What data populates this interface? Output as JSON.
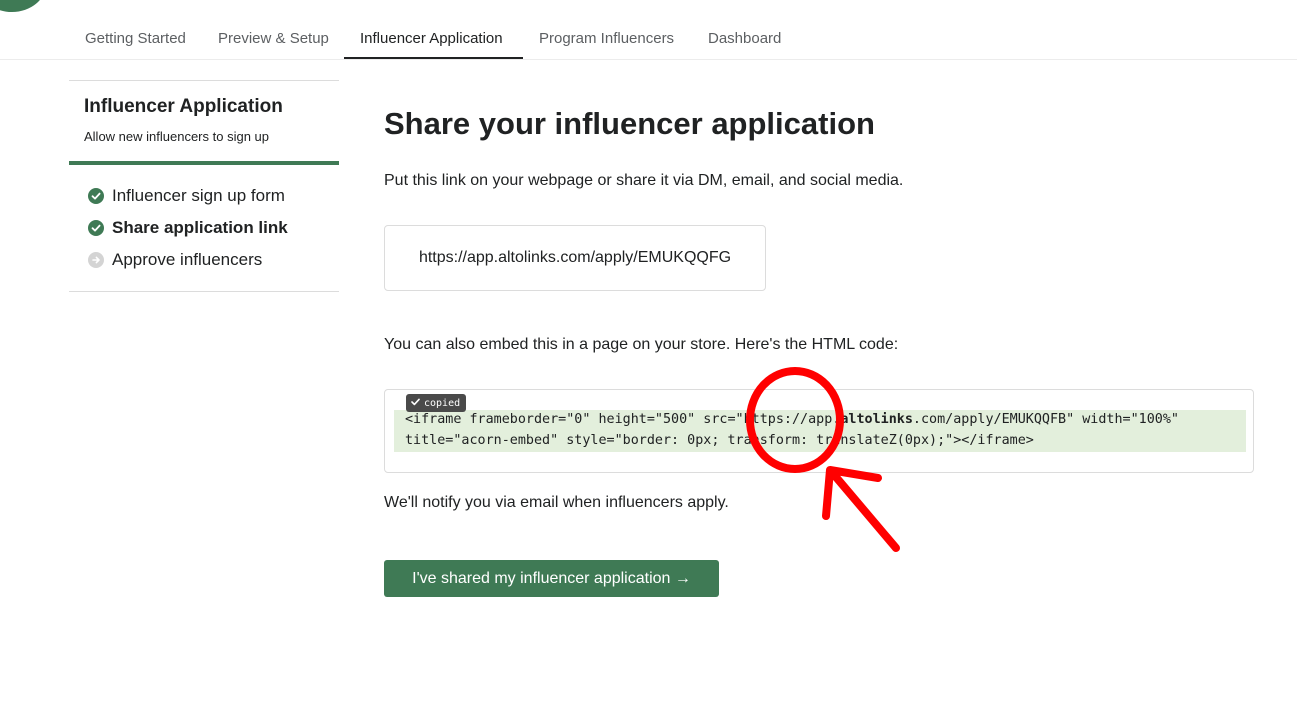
{
  "tabs": [
    {
      "label": "Getting Started",
      "active": false
    },
    {
      "label": "Preview & Setup",
      "active": false
    },
    {
      "label": "Influencer Application",
      "active": true
    },
    {
      "label": "Program Influencers",
      "active": false
    },
    {
      "label": "Dashboard",
      "active": false
    }
  ],
  "sidebar": {
    "title": "Influencer Application",
    "subtitle": "Allow new influencers to sign up",
    "steps": [
      {
        "label": "Influencer sign up form",
        "status": "complete",
        "icon": "check-circle-icon"
      },
      {
        "label": "Share application link",
        "status": "current",
        "icon": "check-circle-icon"
      },
      {
        "label": "Approve influencers",
        "status": "pending",
        "icon": "arrow-circle-icon"
      }
    ]
  },
  "main": {
    "heading": "Share your influencer application",
    "description": "Put this link on your webpage or share it via DM, email, and social media.",
    "application_link": "https://app.altolinks.com/apply/EMUKQQFG",
    "embed_description": "You can also embed this in a page on your store. Here's the HTML code:",
    "copied_badge": "copied",
    "embed_code": {
      "line1_prefix": "<iframe frameborder=\"0\" height=\"500\" src=\"https://app.",
      "line1_bold": "altolinks",
      "line1_suffix": ".com/apply/EMUKQQFB\" width=\"100%\"",
      "line2": "title=\"acorn-embed\" style=\"border: 0px; transform: translateZ(0px);\"></iframe>"
    },
    "notify_text": "We'll notify you via email when influencers apply.",
    "cta_label": "I've shared my influencer application →"
  },
  "colors": {
    "brand_green": "#3f7a55",
    "code_highlight": "#e3efdc",
    "annotation_red": "#ff0000"
  }
}
